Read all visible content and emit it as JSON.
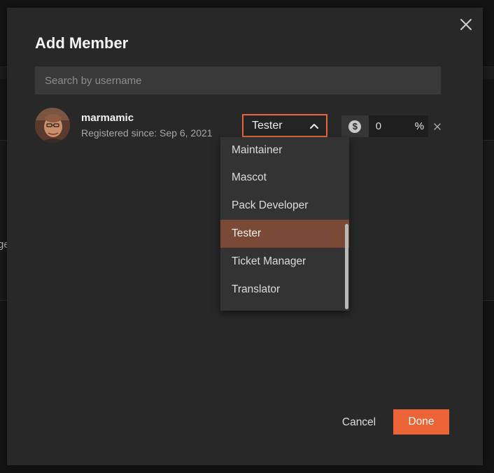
{
  "background": {
    "partial_text": "ge"
  },
  "modal": {
    "title": "Add Member",
    "close_icon": "close-icon",
    "search": {
      "placeholder": "Search by username",
      "value": ""
    },
    "member": {
      "username": "marmamic",
      "registered": "Registered since: Sep 6, 2021",
      "role": {
        "selected": "Tester",
        "icon": "chevron-up-icon"
      },
      "share": {
        "icon": "dollar-coin-icon",
        "value": "0",
        "unit": "%"
      },
      "remove_icon": "close-icon"
    },
    "role_options": [
      {
        "label": "Maintainer"
      },
      {
        "label": "Mascot"
      },
      {
        "label": "Pack Developer"
      },
      {
        "label": "Tester"
      },
      {
        "label": "Ticket Manager"
      },
      {
        "label": "Translator"
      }
    ],
    "selected_index": 3,
    "footer": {
      "cancel_label": "Cancel",
      "done_label": "Done"
    }
  },
  "colors": {
    "accent": "#ec6436",
    "selected_item": "#7a4a37",
    "modal_bg": "#282829"
  }
}
